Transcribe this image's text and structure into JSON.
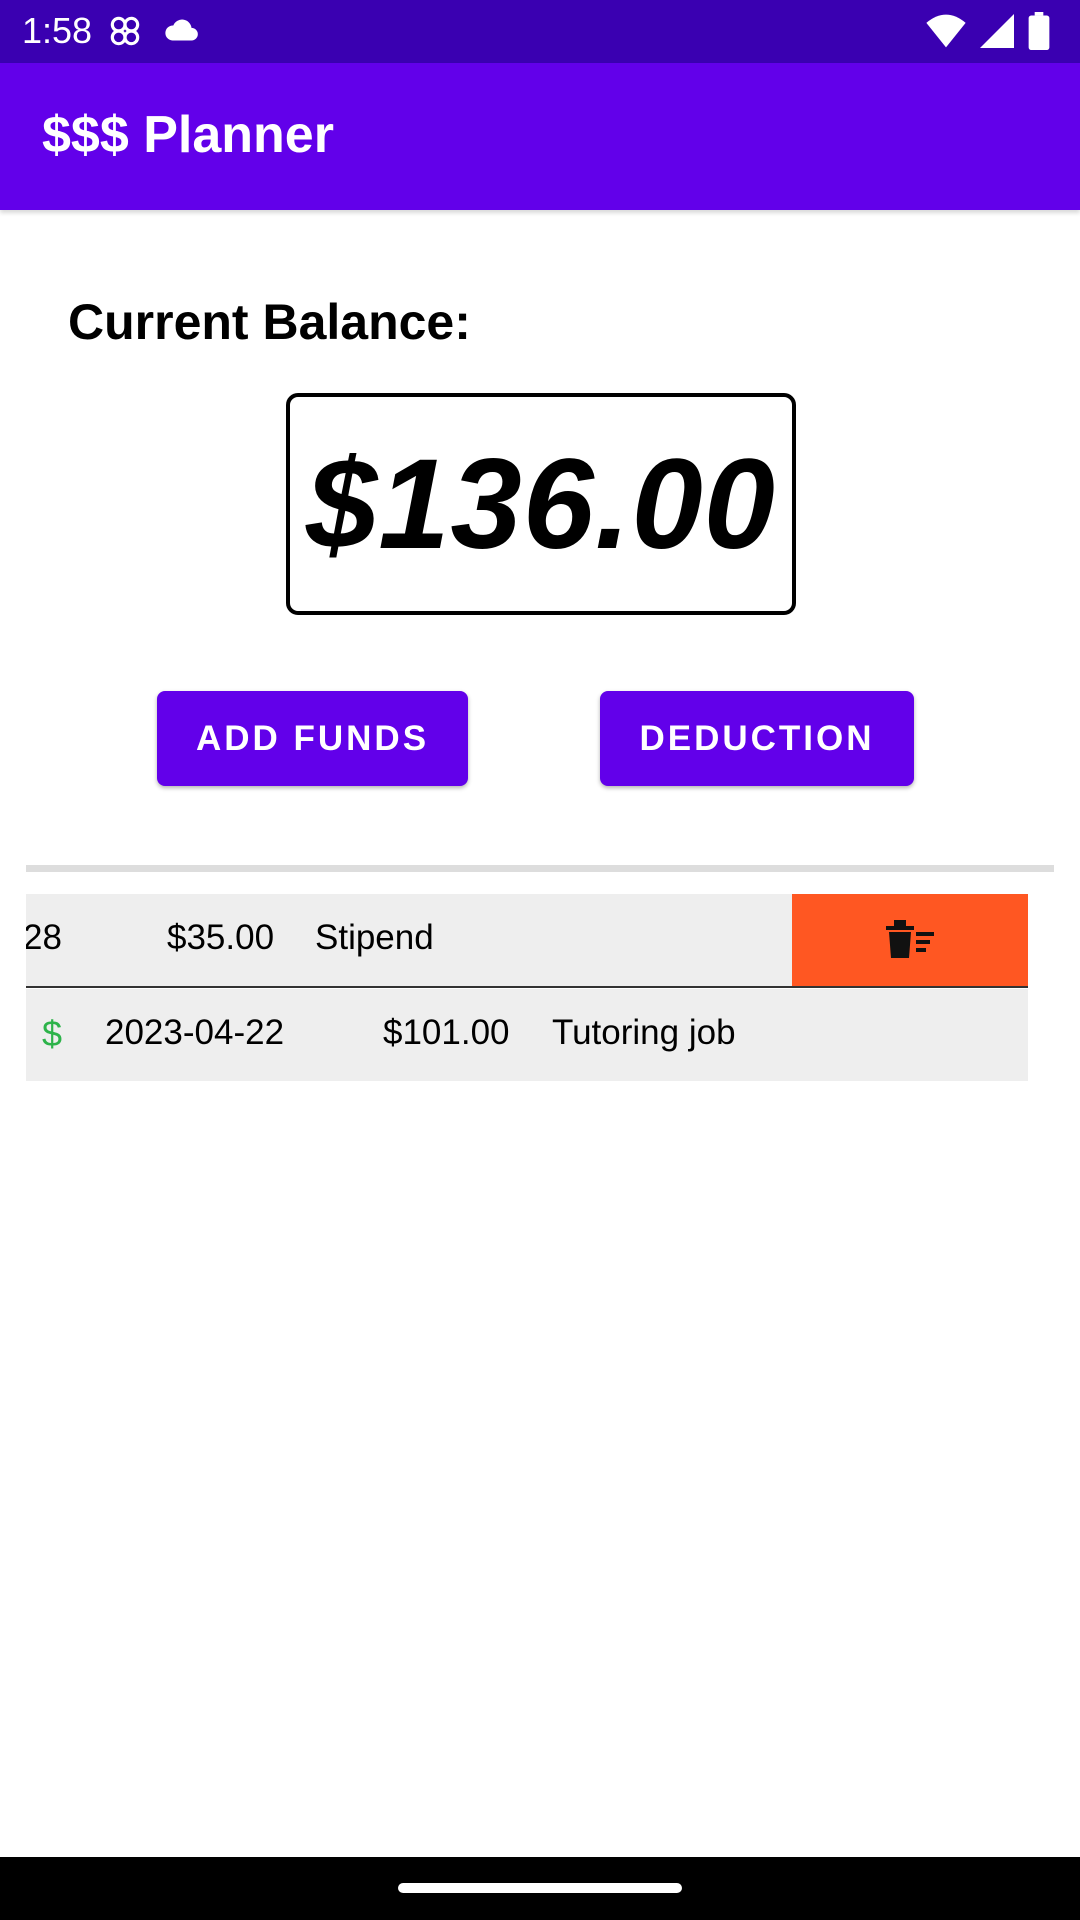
{
  "status_bar": {
    "time": "1:58",
    "icons_left": [
      "pinwheel-icon",
      "cloud-icon"
    ],
    "icons_right": [
      "wifi-icon",
      "cell-signal-icon",
      "battery-icon"
    ]
  },
  "app_bar": {
    "title": "$$$ Planner"
  },
  "balance": {
    "label": "Current Balance:",
    "value": "$136.00"
  },
  "actions": {
    "add_funds": "ADD FUNDS",
    "deduction": "DEDUCTION"
  },
  "transactions": [
    {
      "date_visible": "28",
      "amount": "$35.00",
      "description": "Stipend",
      "swiped": true
    },
    {
      "icon": "$",
      "date": "2023-04-22",
      "amount": "$101.00",
      "description": "Tutoring job",
      "swiped": false
    }
  ],
  "colors": {
    "primary": "#6200ea",
    "primary_dark": "#3a00b1",
    "delete": "#ff5722",
    "income": "#2db34a",
    "row_bg": "#eeeeee"
  }
}
